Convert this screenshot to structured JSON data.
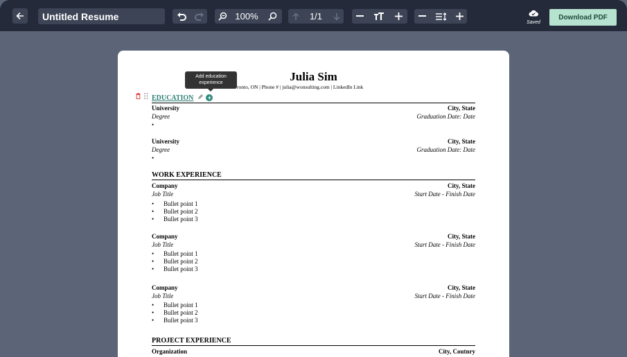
{
  "toolbar": {
    "title_value": "Untitled Resume",
    "zoom_label": "100%",
    "page_indicator": "1/1",
    "saved_label": "Saved",
    "download_label": "Download PDF"
  },
  "resume": {
    "name": "Julia Sim",
    "contact_visible": "ronto, ON | Phone # | julia@wonsulting.com | LinkedIn Link",
    "tooltip": "Add education experience",
    "education": {
      "heading": "EDUCATION",
      "entries": [
        {
          "school": "University",
          "location": "City, State",
          "degree": "Degree",
          "date": "Graduation Date: Date",
          "bullet": "•"
        },
        {
          "school": "University",
          "location": "City, State",
          "degree": "Degree",
          "date": "Graduation Date: Date",
          "bullet": "•"
        }
      ]
    },
    "work": {
      "heading": "WORK EXPERIENCE",
      "entries": [
        {
          "company": "Company",
          "location": "City, State",
          "title": "Job Title",
          "dates": "Start Date - Finish Date",
          "bullets": [
            "Bullet point 1",
            "Bullet point 2",
            "Bullet point 3"
          ]
        },
        {
          "company": "Company",
          "location": "City, State",
          "title": "Job Title",
          "dates": "Start Date - Finish Date",
          "bullets": [
            "Bullet point 1",
            "Bullet point 2",
            "Bullet point 3"
          ]
        },
        {
          "company": "Company",
          "location": "City, State",
          "title": "Job Title",
          "dates": "Start Date - Finish Date",
          "bullets": [
            "Bullet point 1",
            "Bullet point 2",
            "Bullet point 3"
          ]
        }
      ]
    },
    "projects": {
      "heading": "PROJECT EXPERIENCE",
      "entries": [
        {
          "organization": "Organization",
          "location": "City, Coutnry"
        }
      ]
    }
  },
  "icons": {
    "back": "back-arrow-icon",
    "undo": "undo-icon",
    "redo": "redo-icon",
    "zoom_out": "zoom-out-icon",
    "zoom_in": "zoom-in-icon",
    "page_up": "arrow-up-icon",
    "page_down": "arrow-down-icon",
    "font_size": "font-size-icon",
    "line_spacing": "line-spacing-icon",
    "cloud_saved": "cloud-check-icon",
    "trash": "trash-icon",
    "drag": "drag-handle-icon",
    "edit": "pencil-icon",
    "add": "plus-circle-icon"
  },
  "colors": {
    "toolbar_bg": "#242a3a",
    "canvas_bg": "#5c6478",
    "download_bg": "#b6e3cf",
    "section_accent": "#2a7f75",
    "trash": "#e04040"
  }
}
